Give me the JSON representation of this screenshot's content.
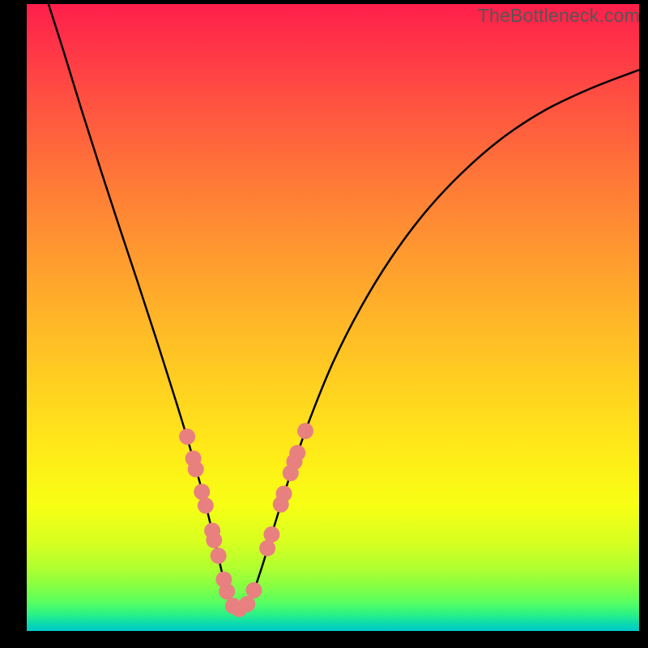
{
  "watermark": "TheBottleneck.com",
  "chart_data": {
    "type": "line",
    "title": "",
    "xlabel": "",
    "ylabel": "",
    "xlim": [
      0,
      756
    ],
    "ylim": [
      0,
      774
    ],
    "curve": {
      "note": "Asymmetric V-shaped bottleneck curve; y is fraction of height from top (0=top, 1=bottom). Minimum near x≈0.347.",
      "points": [
        {
          "x": 0.029,
          "y": -0.02
        },
        {
          "x": 0.06,
          "y": 0.075
        },
        {
          "x": 0.09,
          "y": 0.17
        },
        {
          "x": 0.12,
          "y": 0.262
        },
        {
          "x": 0.15,
          "y": 0.352
        },
        {
          "x": 0.18,
          "y": 0.44
        },
        {
          "x": 0.21,
          "y": 0.53
        },
        {
          "x": 0.24,
          "y": 0.622
        },
        {
          "x": 0.265,
          "y": 0.702
        },
        {
          "x": 0.29,
          "y": 0.79
        },
        {
          "x": 0.31,
          "y": 0.87
        },
        {
          "x": 0.325,
          "y": 0.93
        },
        {
          "x": 0.338,
          "y": 0.96
        },
        {
          "x": 0.347,
          "y": 0.965
        },
        {
          "x": 0.358,
          "y": 0.96
        },
        {
          "x": 0.37,
          "y": 0.938
        },
        {
          "x": 0.385,
          "y": 0.895
        },
        {
          "x": 0.405,
          "y": 0.83
        },
        {
          "x": 0.43,
          "y": 0.752
        },
        {
          "x": 0.46,
          "y": 0.668
        },
        {
          "x": 0.5,
          "y": 0.572
        },
        {
          "x": 0.545,
          "y": 0.485
        },
        {
          "x": 0.595,
          "y": 0.405
        },
        {
          "x": 0.65,
          "y": 0.333
        },
        {
          "x": 0.71,
          "y": 0.27
        },
        {
          "x": 0.775,
          "y": 0.215
        },
        {
          "x": 0.845,
          "y": 0.17
        },
        {
          "x": 0.92,
          "y": 0.135
        },
        {
          "x": 1.0,
          "y": 0.105
        }
      ]
    },
    "markers": {
      "note": "Salmon-pink circular markers clustered near the bottom of the V; positions are (x,y) fractions as above.",
      "radius_px": 10,
      "points": [
        {
          "x": 0.262,
          "y": 0.69
        },
        {
          "x": 0.272,
          "y": 0.725
        },
        {
          "x": 0.276,
          "y": 0.742
        },
        {
          "x": 0.286,
          "y": 0.778
        },
        {
          "x": 0.292,
          "y": 0.8
        },
        {
          "x": 0.303,
          "y": 0.84
        },
        {
          "x": 0.306,
          "y": 0.855
        },
        {
          "x": 0.313,
          "y": 0.88
        },
        {
          "x": 0.322,
          "y": 0.918
        },
        {
          "x": 0.327,
          "y": 0.937
        },
        {
          "x": 0.337,
          "y": 0.96
        },
        {
          "x": 0.347,
          "y": 0.965
        },
        {
          "x": 0.36,
          "y": 0.957
        },
        {
          "x": 0.371,
          "y": 0.935
        },
        {
          "x": 0.393,
          "y": 0.868
        },
        {
          "x": 0.4,
          "y": 0.846
        },
        {
          "x": 0.415,
          "y": 0.798
        },
        {
          "x": 0.42,
          "y": 0.781
        },
        {
          "x": 0.431,
          "y": 0.748
        },
        {
          "x": 0.437,
          "y": 0.73
        },
        {
          "x": 0.442,
          "y": 0.716
        },
        {
          "x": 0.455,
          "y": 0.681
        }
      ]
    }
  }
}
